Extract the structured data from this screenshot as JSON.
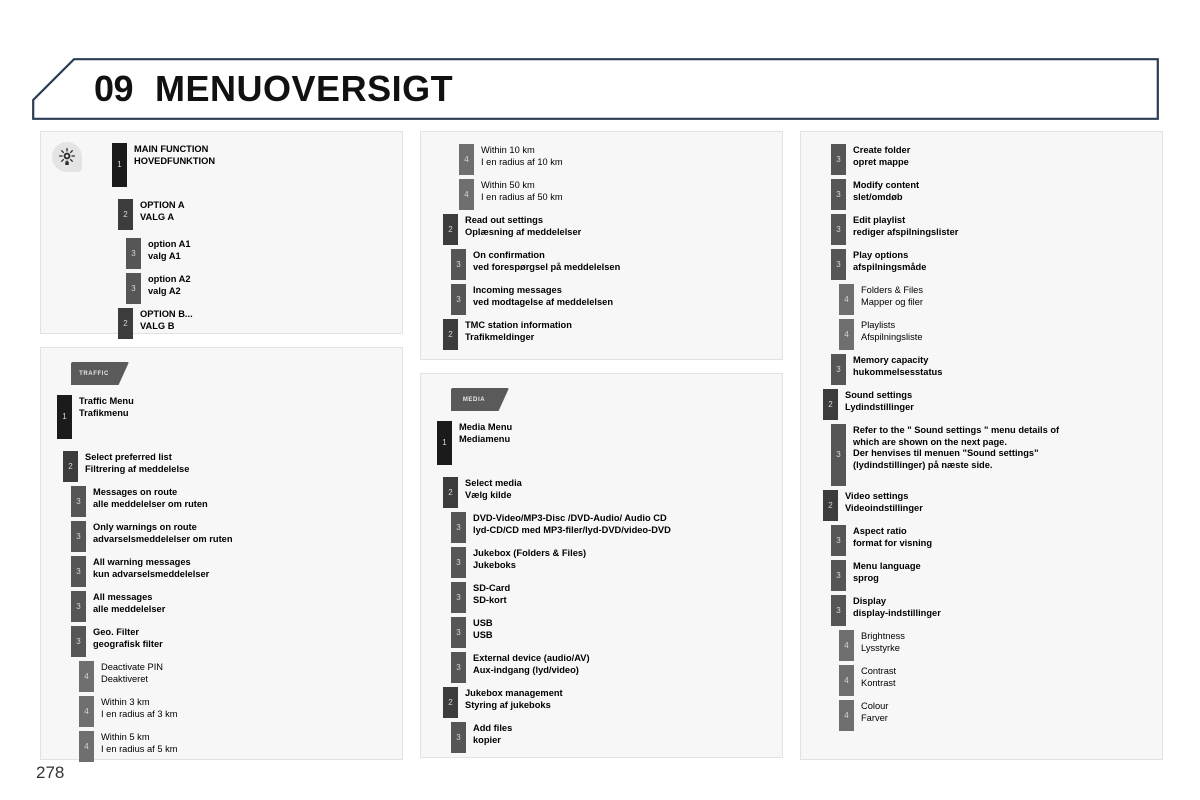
{
  "header": {
    "chapter_number": "09",
    "title": "MENUOVERSIGT"
  },
  "page_number": "278",
  "colors": {
    "header_border": "#2c3e53",
    "level1_bar": "#1b1b1b",
    "level2_bar": "#3c3c3c",
    "level3_bar": "#565656",
    "level4_bar": "#6f6f6f",
    "panel_bg": "#f7f7f7",
    "panel_border": "#e2e2e2",
    "tab_badge": "#5a5a5a"
  },
  "legend_panel": {
    "icon_name": "main-function-icon",
    "rows": [
      {
        "level": "1",
        "en": "MAIN FUNCTION",
        "da": "HOVEDFUNKTION"
      },
      {
        "level": "2",
        "en": "OPTION A",
        "da": "VALG A"
      },
      {
        "level": "3",
        "en": "option A1",
        "da": "valg A1"
      },
      {
        "level": "3",
        "en": "option A2",
        "da": "valg A2"
      },
      {
        "level": "2",
        "en": "OPTION B...",
        "da": "VALG B"
      }
    ]
  },
  "traffic_panel": {
    "tab_label": "TRAFFIC",
    "rows": [
      {
        "level": "1",
        "en": "Traffic Menu",
        "da": "Trafikmenu"
      },
      {
        "level": "2",
        "en": "Select preferred list",
        "da": "Filtrering af meddelelse"
      },
      {
        "level": "3",
        "en": "Messages on route",
        "da": "alle meddelelser om ruten"
      },
      {
        "level": "3",
        "en": "Only warnings on route",
        "da": "advarselsmeddelelser om ruten"
      },
      {
        "level": "3",
        "en": "All warning messages",
        "da": "kun advarselsmeddelelser"
      },
      {
        "level": "3",
        "en": "All messages",
        "da": "alle meddelelser"
      },
      {
        "level": "3",
        "en": "Geo. Filter",
        "da": "geografisk filter"
      },
      {
        "level": "4",
        "en": "Deactivate PIN",
        "da": "Deaktiveret"
      },
      {
        "level": "4",
        "en": "Within 3 km",
        "da": "I en radius af 3 km"
      },
      {
        "level": "4",
        "en": "Within 5 km",
        "da": "I en radius af 5 km"
      }
    ]
  },
  "traffic_panel_cont": {
    "rows": [
      {
        "level": "4",
        "en": "Within 10 km",
        "da": "I en radius af 10 km"
      },
      {
        "level": "4",
        "en": "Within 50 km",
        "da": "I en radius af 50 km"
      },
      {
        "level": "2",
        "en": "Read out settings",
        "da": "Oplæsning af meddelelser"
      },
      {
        "level": "3",
        "en": "On confirmation",
        "da": "ved forespørgsel på meddelelsen"
      },
      {
        "level": "3",
        "en": "Incoming messages",
        "da": "ved modtagelse af meddelelsen"
      },
      {
        "level": "2",
        "en": "TMC station information",
        "da": "Trafikmeldinger"
      }
    ]
  },
  "media_panel": {
    "tab_label": "MEDIA",
    "rows": [
      {
        "level": "1",
        "en": "Media Menu",
        "da": "Mediamenu"
      },
      {
        "level": "2",
        "en": "Select media",
        "da": "Vælg kilde"
      },
      {
        "level": "3",
        "en": "DVD-Video/MP3-Disc /DVD-Audio/ Audio CD",
        "da": "lyd-CD/CD med MP3-filer/lyd-DVD/video-DVD"
      },
      {
        "level": "3",
        "en": "Jukebox (Folders & Files)",
        "da": "Jukeboks"
      },
      {
        "level": "3",
        "en": "SD-Card",
        "da": "SD-kort"
      },
      {
        "level": "3",
        "en": "USB",
        "da": "USB"
      },
      {
        "level": "3",
        "en": "External device (audio/AV)",
        "da": "Aux-indgang (lyd/video)"
      },
      {
        "level": "2",
        "en": "Jukebox management",
        "da": "Styring af jukeboks"
      },
      {
        "level": "3",
        "en": "Add files",
        "da": "kopier"
      }
    ]
  },
  "right_panel": {
    "rows": [
      {
        "level": "3",
        "en": "Create folder",
        "da": "opret mappe"
      },
      {
        "level": "3",
        "en": "Modify content",
        "da": "slet/omdøb"
      },
      {
        "level": "3",
        "en": "Edit playlist",
        "da": "rediger afspilningslister"
      },
      {
        "level": "3",
        "en": "Play options",
        "da": "afspilningsmåde"
      },
      {
        "level": "4",
        "en": "Folders & Files",
        "da": "Mapper og filer"
      },
      {
        "level": "4",
        "en": "Playlists",
        "da": "Afspilningsliste"
      },
      {
        "level": "3",
        "en": "Memory capacity",
        "da": "hukommelsesstatus"
      },
      {
        "level": "2",
        "en": "Sound settings",
        "da": "Lydindstillinger"
      },
      {
        "level": "3",
        "note_lines": [
          "Refer to the \" Sound settings \" menu details of",
          "which are shown on the next page.",
          "Der henvises til menuen \"Sound settings\"",
          "(lydindstillinger) på næste side."
        ]
      },
      {
        "level": "2",
        "en": "Video settings",
        "da": "Videoindstillinger"
      },
      {
        "level": "3",
        "en": "Aspect ratio",
        "da": "format for visning"
      },
      {
        "level": "3",
        "en": "Menu language",
        "da": "sprog"
      },
      {
        "level": "3",
        "en": "Display",
        "da": "display-indstillinger"
      },
      {
        "level": "4",
        "en": "Brightness",
        "da": "Lysstyrke"
      },
      {
        "level": "4",
        "en": "Contrast",
        "da": "Kontrast"
      },
      {
        "level": "4",
        "en": "Colour",
        "da": "Farver"
      }
    ]
  }
}
